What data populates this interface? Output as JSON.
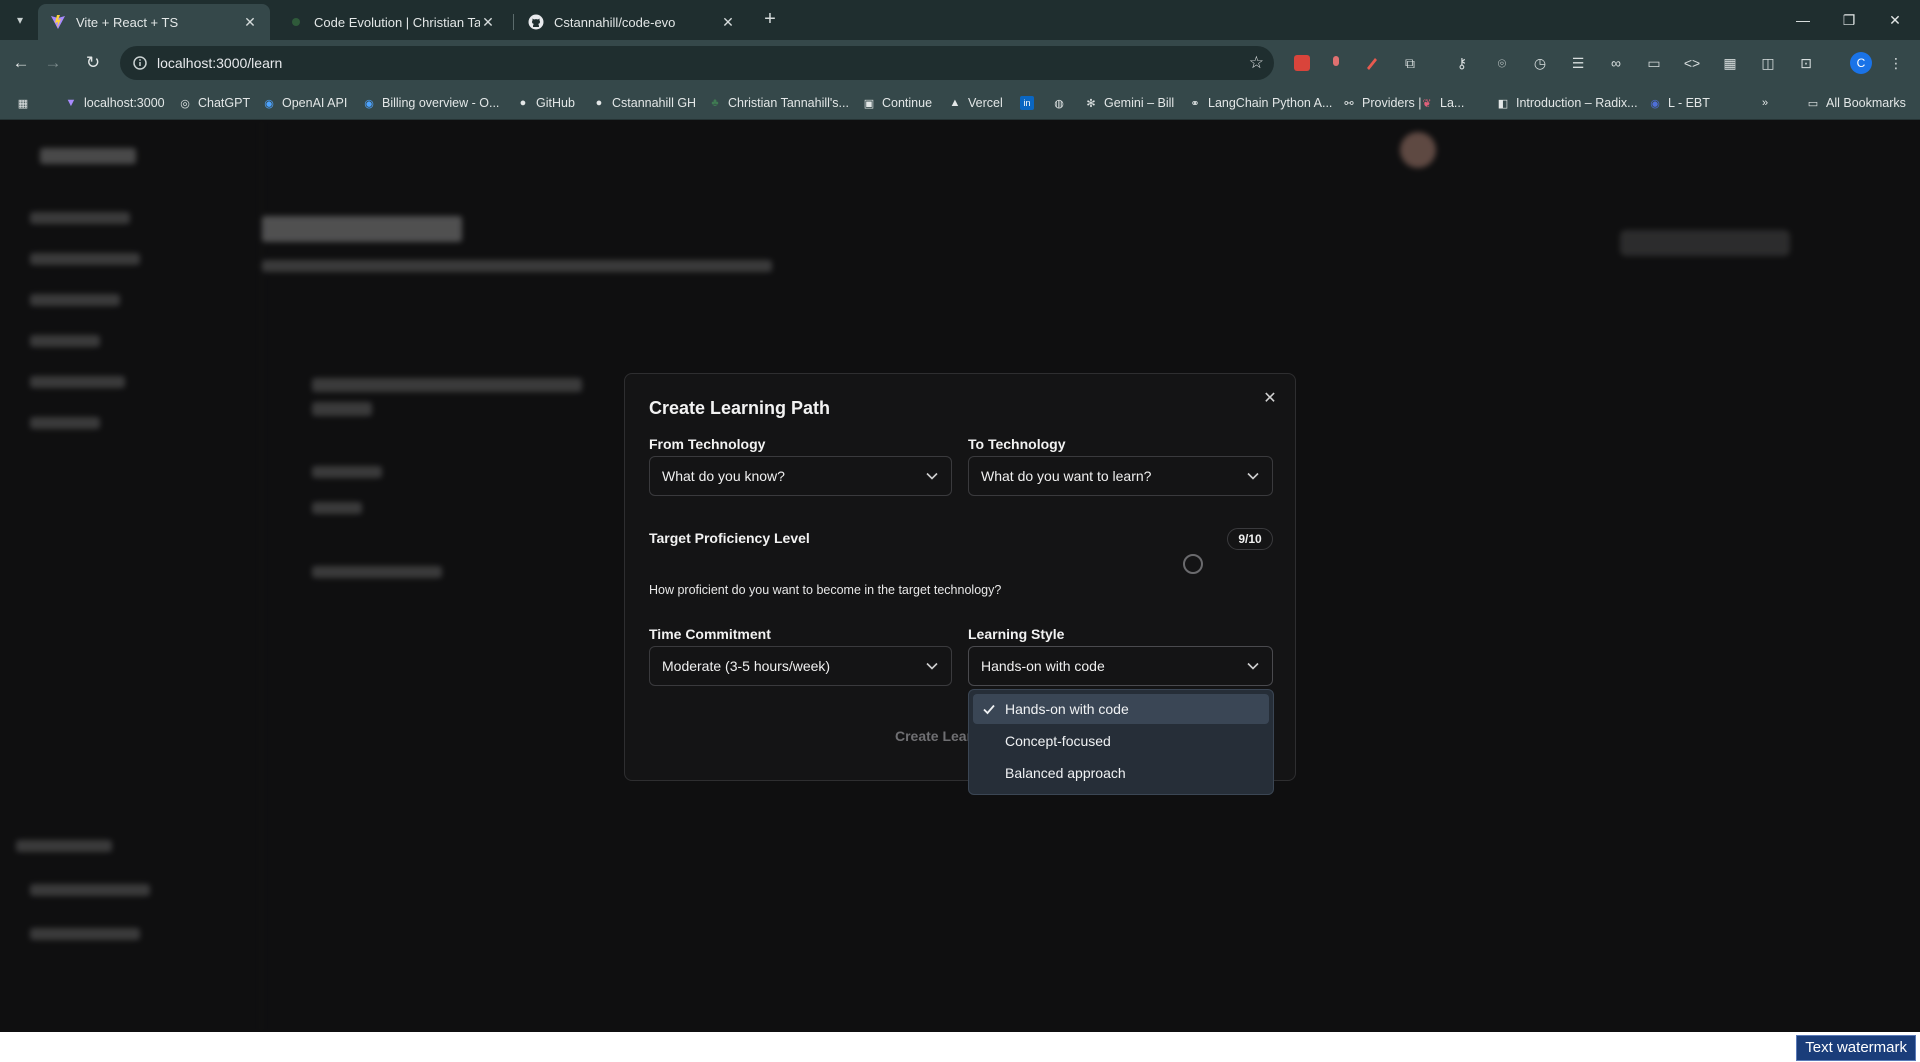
{
  "browser": {
    "tabs": [
      {
        "title": "Vite + React + TS",
        "active": true
      },
      {
        "title": "Code Evolution | Christian Tannahill",
        "active": false
      },
      {
        "title": "Cstannahill/code-evo",
        "active": false
      }
    ],
    "url": "localhost:3000/learn",
    "profile_initial": "C",
    "bookmarks": [
      "localhost:3000",
      "ChatGPT",
      "OpenAI API",
      "Billing overview - O...",
      "GitHub",
      "Cstannahill GH",
      "Christian Tannahill's...",
      "Continue",
      "Vercel",
      "Gemini – Bill",
      "LangChain Python A...",
      "Providers |",
      "La...",
      "Introduction – Radix...",
      "L - EBT"
    ],
    "all_bookmarks": "All Bookmarks"
  },
  "modal": {
    "title": "Create Learning Path",
    "from_label": "From Technology",
    "from_placeholder": "What do you know?",
    "to_label": "To Technology",
    "to_placeholder": "What do you want to learn?",
    "proficiency_label": "Target Proficiency Level",
    "proficiency_value": "9/10",
    "proficiency_level": 0.9,
    "proficiency_hint": "How proficient do you want to become in the target technology?",
    "time_label": "Time Commitment",
    "time_value": "Moderate (3-5 hours/week)",
    "style_label": "Learning Style",
    "style_value": "Hands-on with code",
    "create_button": "Create Lear",
    "style_options": [
      {
        "label": "Hands-on with code",
        "selected": true
      },
      {
        "label": "Concept-focused",
        "selected": false
      },
      {
        "label": "Balanced approach",
        "selected": false
      }
    ]
  },
  "watermark": "Text watermark",
  "colors": {
    "tabbar": "#1f2e2f",
    "toolbar": "#35484a",
    "page": "#0f0f10",
    "modal": "#141415",
    "dropdown": "#262e38",
    "profile": "#1a73e8"
  }
}
